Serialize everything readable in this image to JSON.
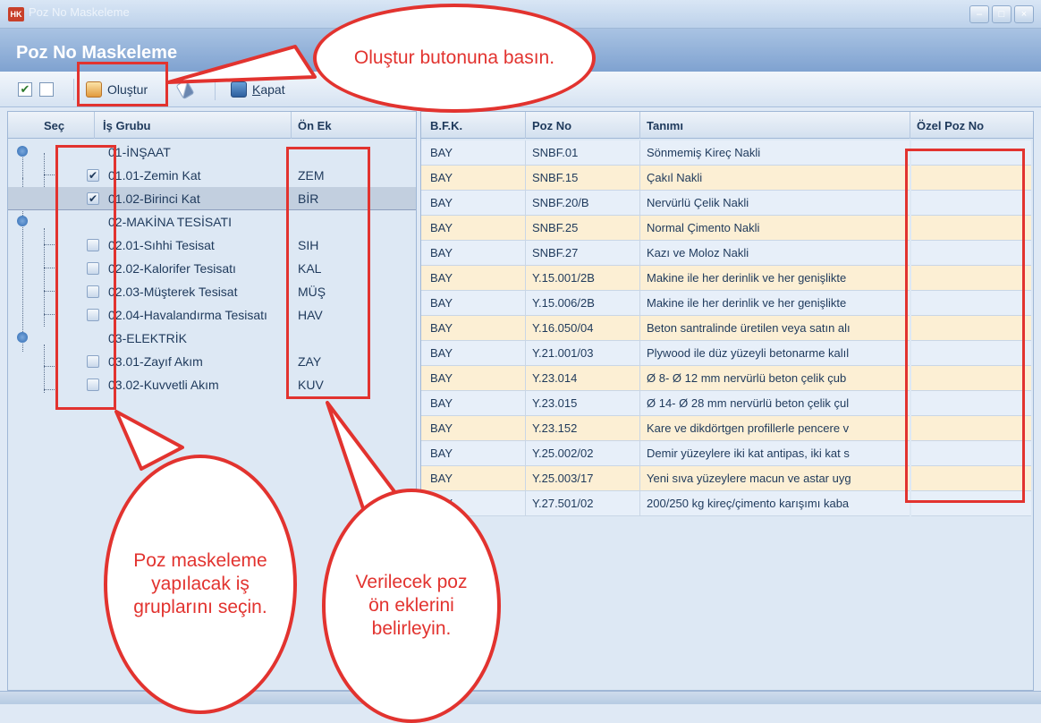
{
  "window": {
    "app_icon_text": "HK",
    "title": "Poz No Maskeleme"
  },
  "header": {
    "title": "Poz No Maskeleme"
  },
  "toolbar": {
    "check_all_mark": "✔",
    "olustur_label": "Oluştur",
    "kapat_label": "Kapat"
  },
  "left_panel": {
    "columns": {
      "sec": "Seç",
      "is_grubu": "İş Grubu",
      "on_ek": "Ön Ek"
    },
    "rows": [
      {
        "label": "01-İNŞAAT",
        "prefix": ""
      },
      {
        "label": "01.01-Zemin Kat",
        "prefix": "ZEM",
        "checked": true
      },
      {
        "label": "01.02-Birinci Kat",
        "prefix": "BİR",
        "checked": true
      },
      {
        "label": "02-MAKİNA TESİSATI",
        "prefix": ""
      },
      {
        "label": "02.01-Sıhhi Tesisat",
        "prefix": "SIH",
        "checked": false
      },
      {
        "label": "02.02-Kalorifer Tesisatı",
        "prefix": "KAL",
        "checked": false
      },
      {
        "label": "02.03-Müşterek Tesisat",
        "prefix": "MÜŞ",
        "checked": false
      },
      {
        "label": "02.04-Havalandırma Tesisatı",
        "prefix": "HAV",
        "checked": false
      },
      {
        "label": "03-ELEKTRİK",
        "prefix": ""
      },
      {
        "label": "03.01-Zayıf Akım",
        "prefix": "ZAY",
        "checked": false
      },
      {
        "label": "03.02-Kuvvetli Akım",
        "prefix": "KUV",
        "checked": false
      }
    ]
  },
  "right_panel": {
    "columns": {
      "bfk": "B.F.K.",
      "poz_no": "Poz No",
      "tanimi": "Tanımı",
      "ozel_poz_no": "Özel Poz No"
    },
    "rows": [
      {
        "bfk": "BAY",
        "poz_no": "SNBF.01",
        "tanimi": "Sönmemiş Kireç Nakli"
      },
      {
        "bfk": "BAY",
        "poz_no": "SNBF.15",
        "tanimi": "Çakıl Nakli"
      },
      {
        "bfk": "BAY",
        "poz_no": "SNBF.20/B",
        "tanimi": "Nervürlü Çelik Nakli"
      },
      {
        "bfk": "BAY",
        "poz_no": "SNBF.25",
        "tanimi": "Normal Çimento Nakli"
      },
      {
        "bfk": "BAY",
        "poz_no": "SNBF.27",
        "tanimi": "Kazı ve Moloz Nakli"
      },
      {
        "bfk": "BAY",
        "poz_no": "Y.15.001/2B",
        "tanimi": "Makine ile her derinlik ve her genişlikte"
      },
      {
        "bfk": "BAY",
        "poz_no": "Y.15.006/2B",
        "tanimi": "Makine ile her derinlik ve her genişlikte"
      },
      {
        "bfk": "BAY",
        "poz_no": "Y.16.050/04",
        "tanimi": "Beton santralinde üretilen veya satın alı"
      },
      {
        "bfk": "BAY",
        "poz_no": "Y.21.001/03",
        "tanimi": "Plywood ile düz yüzeyli betonarme kalıl"
      },
      {
        "bfk": "BAY",
        "poz_no": "Y.23.014",
        "tanimi": "Ø 8- Ø 12 mm nervürlü beton çelik çub"
      },
      {
        "bfk": "BAY",
        "poz_no": "Y.23.015",
        "tanimi": "Ø 14- Ø 28 mm nervürlü beton çelik çul"
      },
      {
        "bfk": "BAY",
        "poz_no": "Y.23.152",
        "tanimi": "Kare ve dikdörtgen profillerle pencere v"
      },
      {
        "bfk": "BAY",
        "poz_no": "Y.25.002/02",
        "tanimi": "Demir yüzeylere iki kat antipas, iki kat s"
      },
      {
        "bfk": "BAY",
        "poz_no": "Y.25.003/17",
        "tanimi": "Yeni sıva yüzeylere macun ve astar uyg"
      },
      {
        "bfk": "BAY",
        "poz_no": "Y.27.501/02",
        "tanimi": "200/250 kg kireç/çimento karışımı kaba"
      }
    ]
  },
  "annotations": {
    "olustur": "Oluştur butonuna basın.",
    "secin": "Poz maskeleme yapılacak iş gruplarını seçin.",
    "onek": "Verilecek poz ön eklerini belirleyin."
  },
  "colors": {
    "annotation_red": "#e2332f",
    "header_blue": "#7fa2d0",
    "row_highlight": "#fcefd4"
  }
}
